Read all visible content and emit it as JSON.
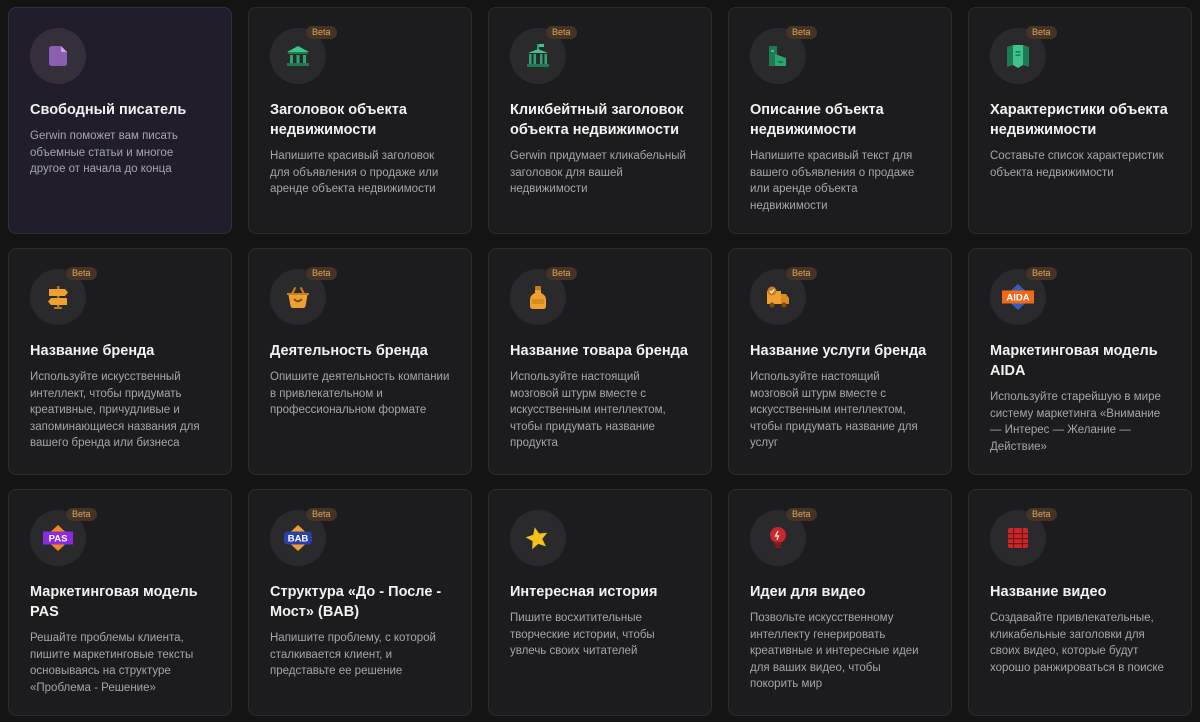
{
  "badge_label": "Beta",
  "colors": {
    "background": "#141414",
    "card": "#1c1c1e",
    "card_active": "#211d2b",
    "beta_text": "#e2a45a",
    "beta_bg": "#433425"
  },
  "cards": [
    {
      "title": "Свободный писатель",
      "desc": "Gerwin поможет вам писать объемные статьи и многое другое от начала до конца",
      "icon": "document-icon",
      "beta": false
    },
    {
      "title": "Заголовок объекта недвижимости",
      "desc": "Напишите красивый заголовок для объявления о продаже или аренде объекта недвижимости",
      "icon": "bank-building-icon",
      "beta": true
    },
    {
      "title": "Кликбейтный заголовок объекта недвижимости",
      "desc": "Gerwin придумает кликабельный заголовок для вашей недвижимости",
      "icon": "columns-building-icon",
      "beta": true
    },
    {
      "title": "Описание объекта недвижимости",
      "desc": "Напишите красивый текст для вашего объявления о продаже или аренде объекта недвижимости",
      "icon": "buildings-icon",
      "beta": true
    },
    {
      "title": "Характеристики объекта недвижимости",
      "desc": "Составьте список характеристик объекта недвижимости",
      "icon": "map-pin-icon",
      "beta": true
    },
    {
      "title": "Название бренда",
      "desc": "Используйте искусственный интеллект, чтобы придумать креативные, причудливые и запоминающиеся названия для вашего бренда или бизнеса",
      "icon": "signpost-icon",
      "beta": true
    },
    {
      "title": "Деятельность бренда",
      "desc": "Опишите деятельность компании в привлекательном и профессиональном формате",
      "icon": "basket-icon",
      "beta": true
    },
    {
      "title": "Название товара бренда",
      "desc": "Используйте настоящий мозговой штурм вместе с искусственным интеллектом, чтобы придумать название продукта",
      "icon": "bottle-icon",
      "beta": true
    },
    {
      "title": "Название услуги бренда",
      "desc": "Используйте настоящий мозговой штурм вместе с искусственным интеллектом, чтобы придумать название для услуг",
      "icon": "delivery-truck-icon",
      "beta": true
    },
    {
      "title": "Маркетинговая модель AIDA",
      "desc": "Используйте старейшую в мире систему маркетинга «Внимание — Интерес — Желание — Действие»",
      "icon": "aida-badge-icon",
      "icon_text": "AIDA",
      "beta": true
    },
    {
      "title": "Маркетинговая модель PAS",
      "desc": "Решайте проблемы клиента, пишите маркетинговые тексты основываясь на структуре «Проблема - Решение»",
      "icon": "pas-badge-icon",
      "icon_text": "PAS",
      "beta": true
    },
    {
      "title": "Структура «До - После - Мост» (BAB)",
      "desc": "Напишите проблему, с которой сталкивается клиент, и представьте ее решение",
      "icon": "bab-badge-icon",
      "icon_text": "BAB",
      "beta": true
    },
    {
      "title": "Интересная история",
      "desc": "Пишите восхитительные творческие истории, чтобы увлечь своих читателей",
      "icon": "star-icon",
      "beta": false
    },
    {
      "title": "Идеи для видео",
      "desc": "Позвольте искусственному интеллекту генерировать креативные и интересные идеи для ваших видео, чтобы покорить мир",
      "icon": "lightbulb-icon",
      "beta": true
    },
    {
      "title": "Название видео",
      "desc": "Создавайте привлекательные, кликабельные заголовки для своих видео, которые будут хорошо ранжироваться в поиске",
      "icon": "film-icon",
      "beta": true
    }
  ]
}
